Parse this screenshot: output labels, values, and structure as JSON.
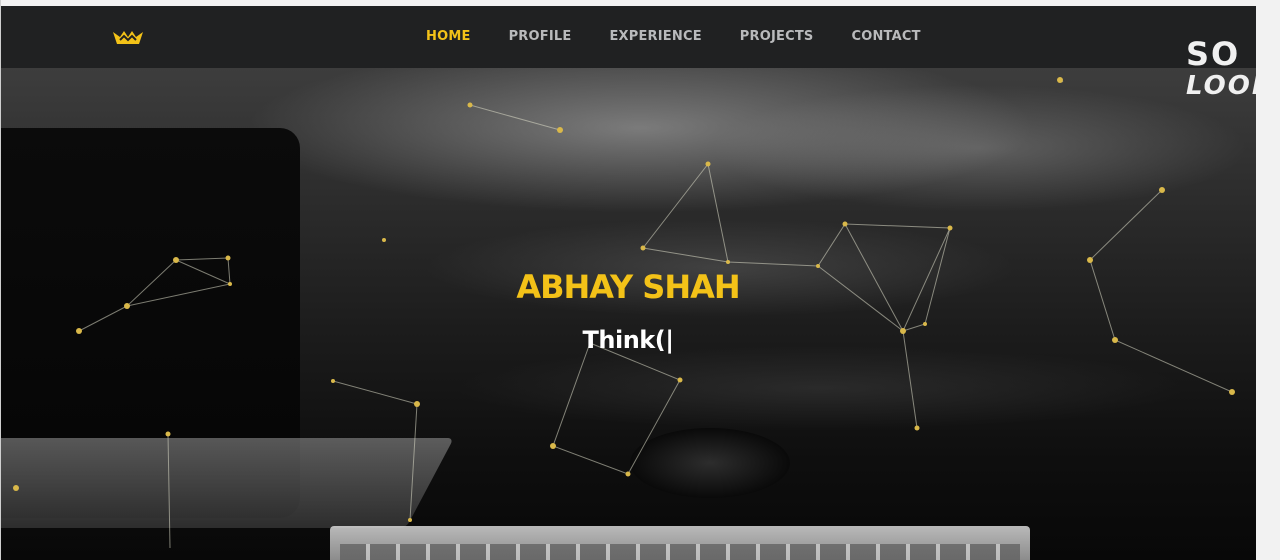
{
  "navbar": {
    "logo_icon": "crown-icon",
    "items": [
      {
        "label": "HOME",
        "active": true
      },
      {
        "label": "PROFILE",
        "active": false
      },
      {
        "label": "EXPERIENCE",
        "active": false
      },
      {
        "label": "PROJECTS",
        "active": false
      },
      {
        "label": "CONTACT",
        "active": false
      }
    ]
  },
  "hero": {
    "title": "ABHAY SHAH",
    "subtitle": "Think(|"
  },
  "watermark": {
    "line1": "SO",
    "line2": "LOOP"
  },
  "colors": {
    "accent": "#f3c218",
    "navbar_bg": "#202122",
    "nav_text": "#b9babc"
  }
}
